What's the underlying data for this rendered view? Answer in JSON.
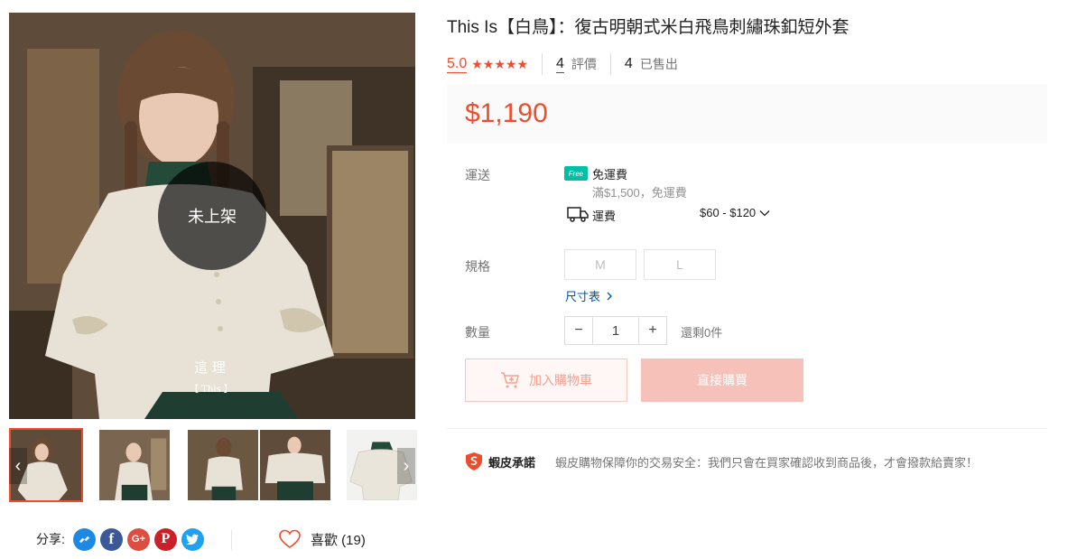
{
  "product": {
    "title": "This Is【白鳥】：復古明朝式米白飛鳥刺繡珠釦短外套",
    "rating": "5.0",
    "stars": "★★★★★",
    "review_count": "4",
    "review_label": "評價",
    "sold_count": "4",
    "sold_label": "已售出",
    "price": "$1,190"
  },
  "gallery": {
    "unlisted_badge": "未上架",
    "watermark_title": "這 理",
    "watermark_sub": "【 This 】",
    "prev_arrow": "‹",
    "next_arrow": "›",
    "thumbnails": [
      "thumb-1",
      "thumb-2",
      "thumb-3",
      "thumb-4",
      "thumb-5"
    ]
  },
  "shipping": {
    "label": "運送",
    "free_icon_text": "Free",
    "free_title": "免運費",
    "free_condition": "滿$1,500，免運費",
    "fee_label": "運費",
    "fee_range": "$60 - $120"
  },
  "variation": {
    "label": "規格",
    "options": [
      "M",
      "L"
    ],
    "size_chart": "尺寸表"
  },
  "quantity": {
    "label": "數量",
    "minus": "−",
    "value": "1",
    "plus": "+",
    "stock": "還剩0件"
  },
  "actions": {
    "add_to_cart": "加入購物車",
    "buy_now": "直接購買"
  },
  "guarantee": {
    "title": "蝦皮承諾",
    "text": "蝦皮購物保障你的交易安全：我們只會在買家確認收到商品後，才會撥款給賣家！"
  },
  "share": {
    "label": "分享:",
    "icons": [
      "messenger-icon",
      "facebook-icon",
      "google-plus-icon",
      "pinterest-icon",
      "twitter-icon"
    ]
  },
  "like": {
    "label": "喜歡 (19)"
  },
  "colors": {
    "accent": "#ee4d2d",
    "free_ship": "#00bfa5",
    "messenger": "#1e88e5",
    "facebook": "#3b5998",
    "google": "#dc4e41",
    "pinterest": "#cb2027",
    "twitter": "#1da1f2"
  }
}
